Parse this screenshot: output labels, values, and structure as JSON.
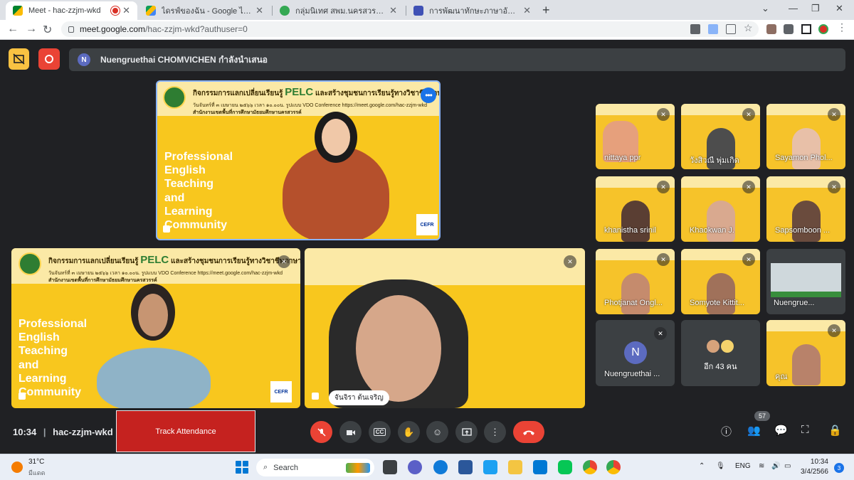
{
  "browser": {
    "tabs": [
      {
        "title": "Meet - hac-zzjm-wkd",
        "active": true,
        "recording": true
      },
      {
        "title": "ไดรฟ์ของฉัน - Google ไดรฟ์",
        "active": false
      },
      {
        "title": "กลุ่มนิเทศ สพม.นครสวรรค์",
        "active": false
      },
      {
        "title": "การพัฒนาทักษะภาษาอังกฤษ English",
        "active": false
      }
    ],
    "new_tab": "+",
    "url_domain": "meet.google.com",
    "url_path": "/hac-zzjm-wkd?authuser=0"
  },
  "meet": {
    "presenter_banner": "Nuengruethai CHOMVICHEN กำลังนำเสนอ",
    "presenter_initial": "N",
    "slide": {
      "heading_prefix": "กิจกรรมการแลกเปลี่ยนเรียนรู้",
      "heading_brand": "PELC",
      "heading_suffix": "และสร้างชุมชนการเรียนรู้ทางวิชาชีพภาษาอังกฤษ",
      "date_line": "วันจันทร์ที่ ๓ เมษายน ๒๕๖๖ เวลา ๑๐.๐๐น. รูปแบบ VDO Conference https://meet.google.com/hac-zzjm-wkd",
      "org_line": "สำนักงานเขตพื้นที่การศึกษามัธยมศึกษานครสวรรค์",
      "title_lines": [
        "Professional",
        "English",
        "Teaching",
        "and",
        "Learning",
        "Community"
      ],
      "cefr": "CEFR"
    },
    "main_tiles": [
      {
        "name": "จันจิรา ต้นเจริญ"
      }
    ],
    "grid": [
      {
        "name": "nittaya ppr",
        "type": "video"
      },
      {
        "name": "วังสิวณี พุ่มเกิด",
        "type": "video"
      },
      {
        "name": "Sayamon Phol...",
        "type": "video"
      },
      {
        "name": "khanistha srinil",
        "type": "video"
      },
      {
        "name": "Khaokwan J.",
        "type": "video"
      },
      {
        "name": "Sapsomboon ...",
        "type": "video"
      },
      {
        "name": "Photjanat Ongl...",
        "type": "video"
      },
      {
        "name": "Somyote Kittit...",
        "type": "video"
      },
      {
        "name": "Nuengrue...",
        "type": "screen"
      },
      {
        "name": "Nuengruethai ...",
        "type": "avatar",
        "initial": "N"
      },
      {
        "name": "อีก 43 คน",
        "type": "more"
      },
      {
        "name": "คุณ",
        "type": "video"
      }
    ],
    "bottom": {
      "time": "10:34",
      "meeting_code": "hac-zzjm-wkd",
      "track_attendance": "Track Attendance",
      "participant_count": "57"
    }
  },
  "taskbar": {
    "temperature": "31°C",
    "weather": "มีแดด",
    "search": "Search",
    "language": "ENG",
    "time": "10:34",
    "date": "3/4/2566",
    "notifications": "3"
  },
  "colors": {
    "meet_bg": "#202124",
    "slide_yellow": "#f8c71e",
    "leave_red": "#ea4335",
    "presenting_yellow": "#f9c242",
    "accent_blue": "#1a73e8"
  }
}
